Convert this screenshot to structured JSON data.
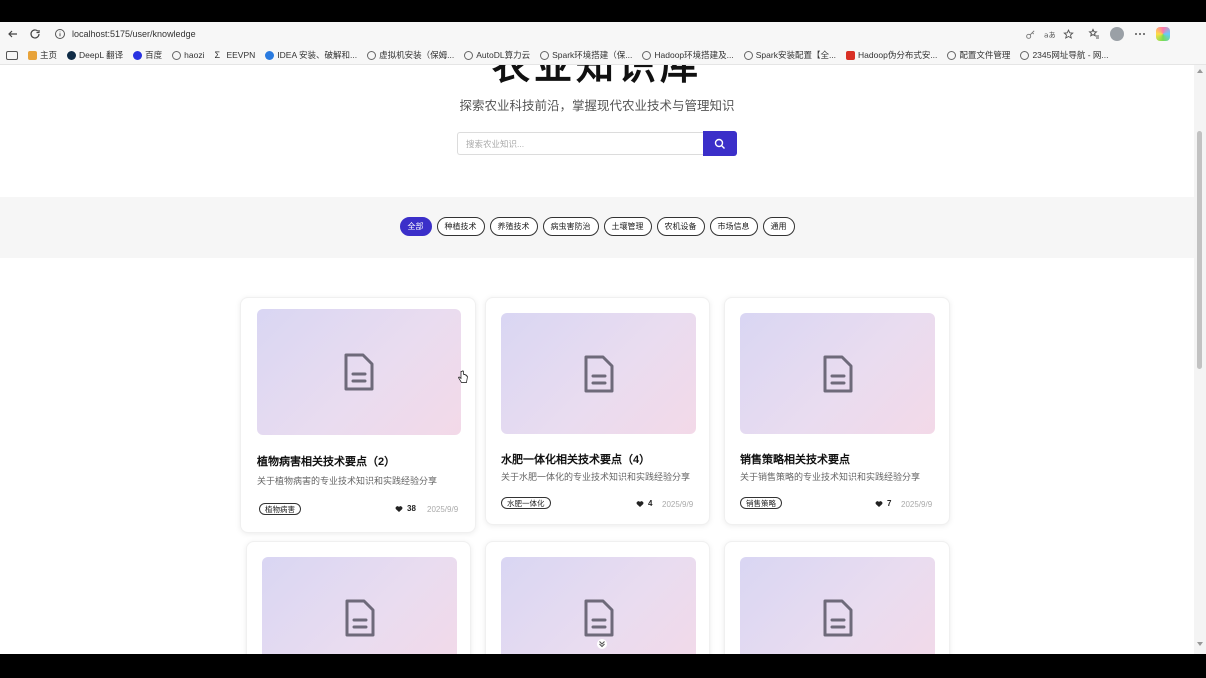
{
  "browser": {
    "url": "localhost:5175/user/knowledge",
    "bookmarks": [
      {
        "label": "主页",
        "icon": "home-icon"
      },
      {
        "label": "DeepL 翻译",
        "icon": "deepl-icon"
      },
      {
        "label": "百度",
        "icon": "baidu-icon"
      },
      {
        "label": "haozi",
        "icon": "globe-icon"
      },
      {
        "label": "EEVPN",
        "icon": "sigma-icon"
      },
      {
        "label": "IDEA 安装、破解和...",
        "icon": "blue-circle-icon"
      },
      {
        "label": "虚拟机安装（保姆...",
        "icon": "globe-icon"
      },
      {
        "label": "AutoDL算力云",
        "icon": "globe-icon"
      },
      {
        "label": "Spark环境搭建（保...",
        "icon": "globe-icon"
      },
      {
        "label": "Hadoop环境搭建及...",
        "icon": "globe-icon"
      },
      {
        "label": "Spark安装配置【全...",
        "icon": "globe-icon"
      },
      {
        "label": "Hadoop伪分布式安...",
        "icon": "red-c-icon"
      },
      {
        "label": "配置文件管理",
        "icon": "globe-icon"
      },
      {
        "label": "2345网址导航 - 网...",
        "icon": "globe-icon"
      }
    ]
  },
  "hero": {
    "title": "农业知识库",
    "subtitle": "探索农业科技前沿，掌握现代农业技术与管理知识"
  },
  "search": {
    "placeholder": "搜索农业知识..."
  },
  "filters": [
    "全部",
    "种植技术",
    "养殖技术",
    "病虫害防治",
    "土壤管理",
    "农机设备",
    "市场信息",
    "通用"
  ],
  "cards": [
    {
      "title": "植物病害相关技术要点（2）",
      "desc": "关于植物病害的专业技术知识和实践经验分享",
      "tag": "植物病害",
      "likes": "38",
      "date": "2025/9/9"
    },
    {
      "title": "水肥一体化相关技术要点（4）",
      "desc": "关于水肥一体化的专业技术知识和实践经验分享",
      "tag": "水肥一体化",
      "likes": "4",
      "date": "2025/9/9"
    },
    {
      "title": "销售策略相关技术要点",
      "desc": "关于销售策略的专业技术知识和实践经验分享",
      "tag": "销售策略",
      "likes": "7",
      "date": "2025/9/9"
    }
  ],
  "colors": {
    "accent": "#3b2fc9",
    "thumb_gradient_start": "#d9d6f3",
    "thumb_gradient_end": "#f3d9e8"
  }
}
